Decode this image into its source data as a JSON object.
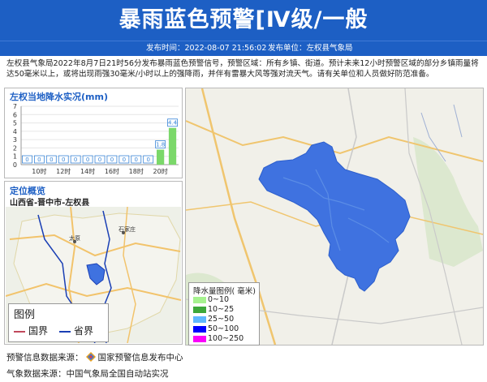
{
  "header": {
    "title": "暴雨蓝色预警[Ⅳ级/一般",
    "time_text": "发布时间：2022-08-07 21:56:02",
    "unit_text": "发布单位：左权县气象局"
  },
  "description": "左权县气象局2022年8月7日21时56分发布暴雨蓝色预警信号，预警区域：所有乡镇、街道。预计未来12小时预警区域的部分乡镇雨量将达50毫米以上，或将出现雨强30毫米/小时以上的强降雨，并伴有雷暴大风等强对流天气。请有关单位和人员做好防范准备。",
  "rain_panel": {
    "title": "左权当地降水实况(mm)",
    "chart_data": {
      "type": "bar",
      "title": "左权当地降水实况(mm)",
      "x": [
        "",
        "10时",
        "",
        "12时",
        "",
        "14时",
        "",
        "16时",
        "",
        "18时",
        "",
        "20时",
        ""
      ],
      "xticks": [
        "10时",
        "12时",
        "14时",
        "16时",
        "18时",
        "20时"
      ],
      "values": [
        0,
        0,
        0,
        0,
        0,
        0,
        0,
        0,
        0,
        0,
        0,
        1.8,
        4.4
      ],
      "labels": [
        "0",
        "0",
        "0",
        "0",
        "0",
        "0",
        "0",
        "0",
        "0",
        "0",
        "0",
        "1.8",
        "4.4"
      ],
      "yticks": [
        0,
        1,
        2,
        3,
        4,
        5,
        6,
        7
      ],
      "ylim": [
        0,
        7
      ],
      "bar_color": "#7bd86a",
      "label_box_color": "#3a86d8"
    }
  },
  "location": {
    "title": "定位概览",
    "region": "山西省-晋中市-左权县",
    "cities": [
      "太原",
      "石家庄"
    ],
    "legend_title": "图例",
    "legend_items": [
      {
        "label": "国界",
        "color": "#c0495b"
      },
      {
        "label": "省界",
        "color": "#1a3fb4"
      }
    ]
  },
  "map_legend": {
    "title": "降水量图例( 毫米)",
    "items": [
      {
        "label": "0~10",
        "color": "#a6f28f"
      },
      {
        "label": "10~25",
        "color": "#3da83a"
      },
      {
        "label": "25~50",
        "color": "#5fb8ff"
      },
      {
        "label": "50~100",
        "color": "#0000fe"
      },
      {
        "label": "100~250",
        "color": "#fa00fa"
      }
    ],
    "area_color": "#3f72e0"
  },
  "footer": {
    "source1_prefix": "预警信息数据来源：",
    "source1_name": "国家预警信息发布中心",
    "source2": "气象数据来源：中国气象局全国自动站实况"
  }
}
